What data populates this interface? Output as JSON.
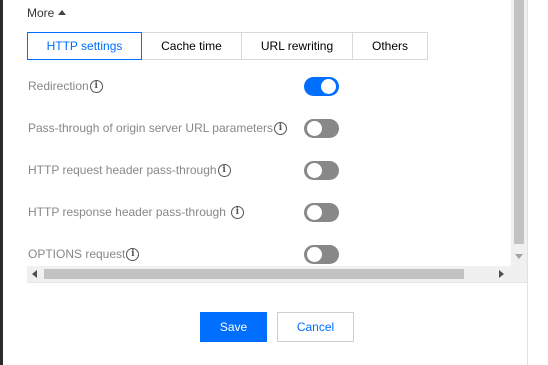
{
  "more_toggle": {
    "label": "More",
    "icon": "caret-up-icon"
  },
  "tabs": [
    {
      "label": "HTTP settings",
      "active": true
    },
    {
      "label": "Cache time",
      "active": false
    },
    {
      "label": "URL rewriting",
      "active": false
    },
    {
      "label": "Others",
      "active": false
    }
  ],
  "settings": [
    {
      "label": "Redirection",
      "info_icon": "info-icon",
      "enabled": true
    },
    {
      "label": "Pass-through of origin server URL parameters",
      "info_icon": "info-icon",
      "enabled": false
    },
    {
      "label": "HTTP request header pass-through",
      "info_icon": "info-icon",
      "enabled": false
    },
    {
      "label": "HTTP response header pass-through",
      "info_icon": "info-icon",
      "enabled": false
    },
    {
      "label": "OPTIONS request",
      "info_icon": "info-icon",
      "enabled": false
    }
  ],
  "info_glyph": "i",
  "footer": {
    "save_label": "Save",
    "cancel_label": "Cancel"
  },
  "colors": {
    "accent": "#006eff",
    "toggle_off": "#888888",
    "label_text": "#888888"
  }
}
